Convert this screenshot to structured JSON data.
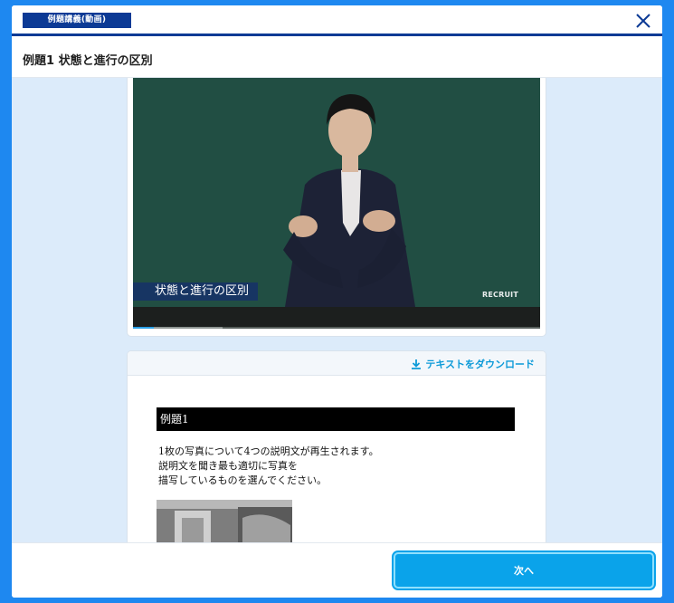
{
  "header": {
    "badge": "例題講義(動画)",
    "close_icon": "close-icon"
  },
  "title": "例題1 状態と進行の区別",
  "video": {
    "caption": "状態と進行の区別",
    "brand": "RECRUIT",
    "progress_fraction": 0.05,
    "buffered_fraction": 0.22
  },
  "text_panel": {
    "download_label": "テキストをダウンロード",
    "download_icon": "download-icon",
    "heading": "例題1",
    "lines": [
      "1枚の写真について4つの説明文が再生されます。",
      "説明文を聞き最も適切に写真を",
      "描写しているものを選んでください。"
    ]
  },
  "footer": {
    "next_label": "次へ"
  },
  "colors": {
    "background": "#1e88f0",
    "header_accent": "#0c3a95",
    "content_bg": "#dcebfa",
    "button": "#0aa3ea",
    "link": "#0c9ad8"
  }
}
